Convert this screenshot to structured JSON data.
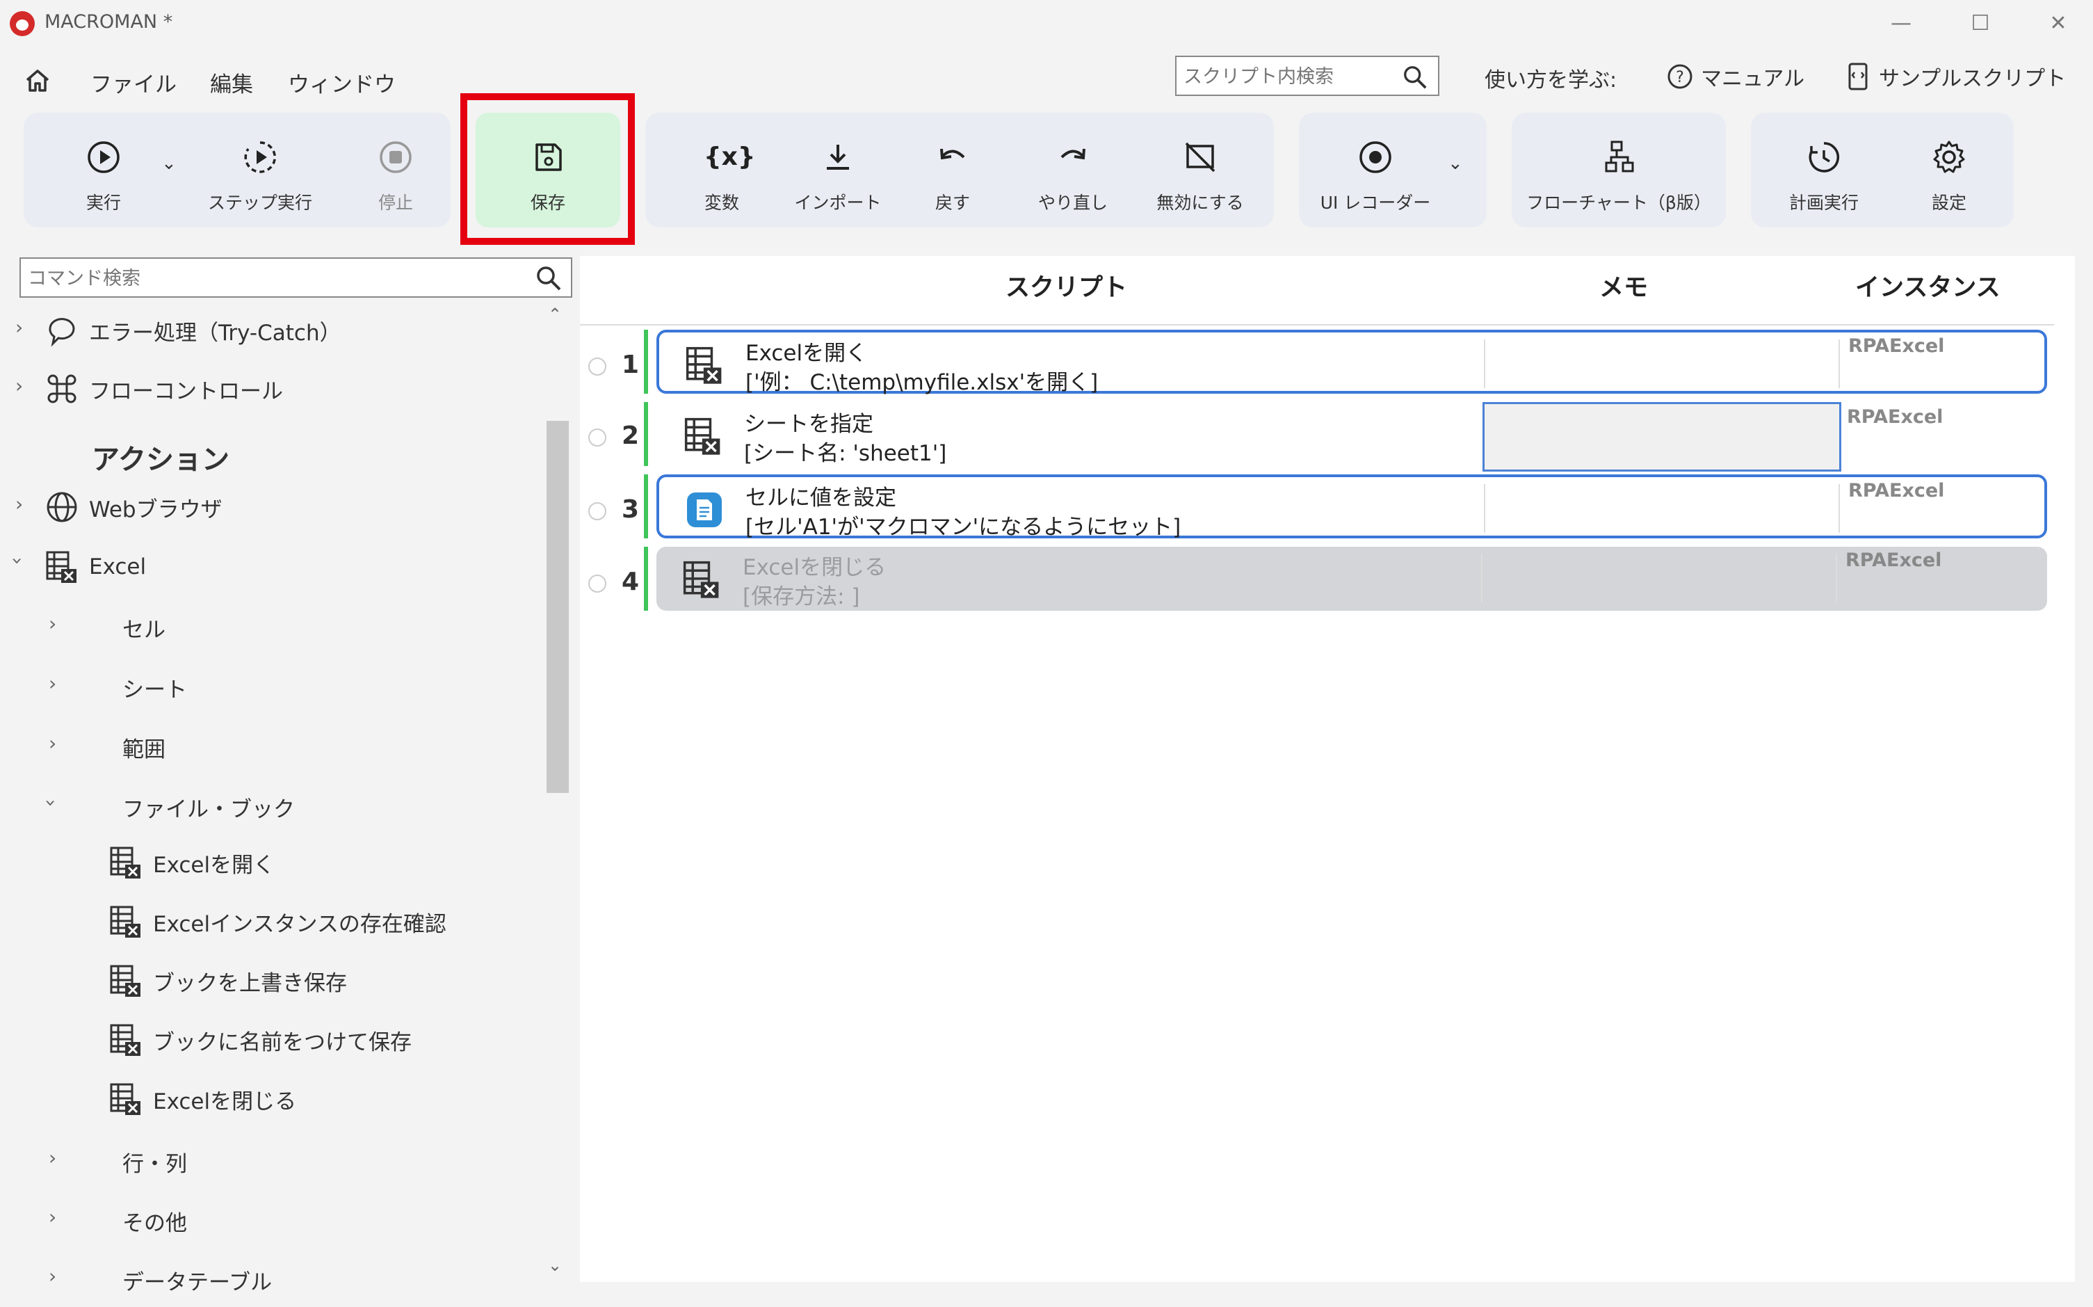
{
  "window": {
    "title": "MACROMAN *",
    "min": "—",
    "max": "☐",
    "close": "✕"
  },
  "menu": {
    "file": "ファイル",
    "edit": "編集",
    "window": "ウィンドウ"
  },
  "search": {
    "placeholder": "スクリプト内検索"
  },
  "learn": {
    "label": "使い方を学ぶ:",
    "manual": "マニュアル",
    "samples": "サンプルスクリプト"
  },
  "toolbar": {
    "run": "実行",
    "step_run": "ステップ実行",
    "stop": "停止",
    "save": "保存",
    "variables": "変数",
    "import": "インポート",
    "undo": "戻す",
    "redo": "やり直し",
    "disable": "無効にする",
    "ui_recorder": "UI レコーダー",
    "flowchart": "フローチャート（β版）",
    "schedule": "計画実行",
    "settings": "設定"
  },
  "sidebar": {
    "search_placeholder": "コマンド検索",
    "error_handling": "エラー処理（Try-Catch）",
    "flow_control": "フローコントロール",
    "actions_title": "アクション",
    "web_browser": "Webブラウザ",
    "excel": "Excel",
    "cell": "セル",
    "sheet": "シート",
    "range": "範囲",
    "file_book": "ファイル・ブック",
    "open_excel": "Excelを開く",
    "check_instance": "Excelインスタンスの存在確認",
    "overwrite_save": "ブックを上書き保存",
    "save_as": "ブックに名前をつけて保存",
    "close_excel": "Excelを閉じる",
    "row_col": "行・列",
    "other": "その他",
    "data_table": "データテーブル"
  },
  "script": {
    "col_script": "スクリプト",
    "col_memo": "メモ",
    "col_instance": "インスタンス",
    "rows": [
      {
        "num": "1",
        "title": "Excelを開く",
        "sub": "['例： C:\\temp\\myfile.xlsx'を開く]",
        "instance": "RPAExcel"
      },
      {
        "num": "2",
        "title": "シートを指定",
        "sub": "[シート名: 'sheet1']",
        "instance": "RPAExcel"
      },
      {
        "num": "3",
        "title": "セルに値を設定",
        "sub": "[セル'A1'が'マクロマン'になるようにセット]",
        "instance": "RPAExcel"
      },
      {
        "num": "4",
        "title": "Excelを閉じる",
        "sub": "[保存方法: ]",
        "instance": "RPAExcel"
      }
    ]
  },
  "colors": {
    "highlight": "#e5000f",
    "save_bg": "#d6f5dc",
    "selection": "#3b78d8",
    "row_marker": "#3fc55a",
    "toolbar_group": "#e9edf3"
  }
}
